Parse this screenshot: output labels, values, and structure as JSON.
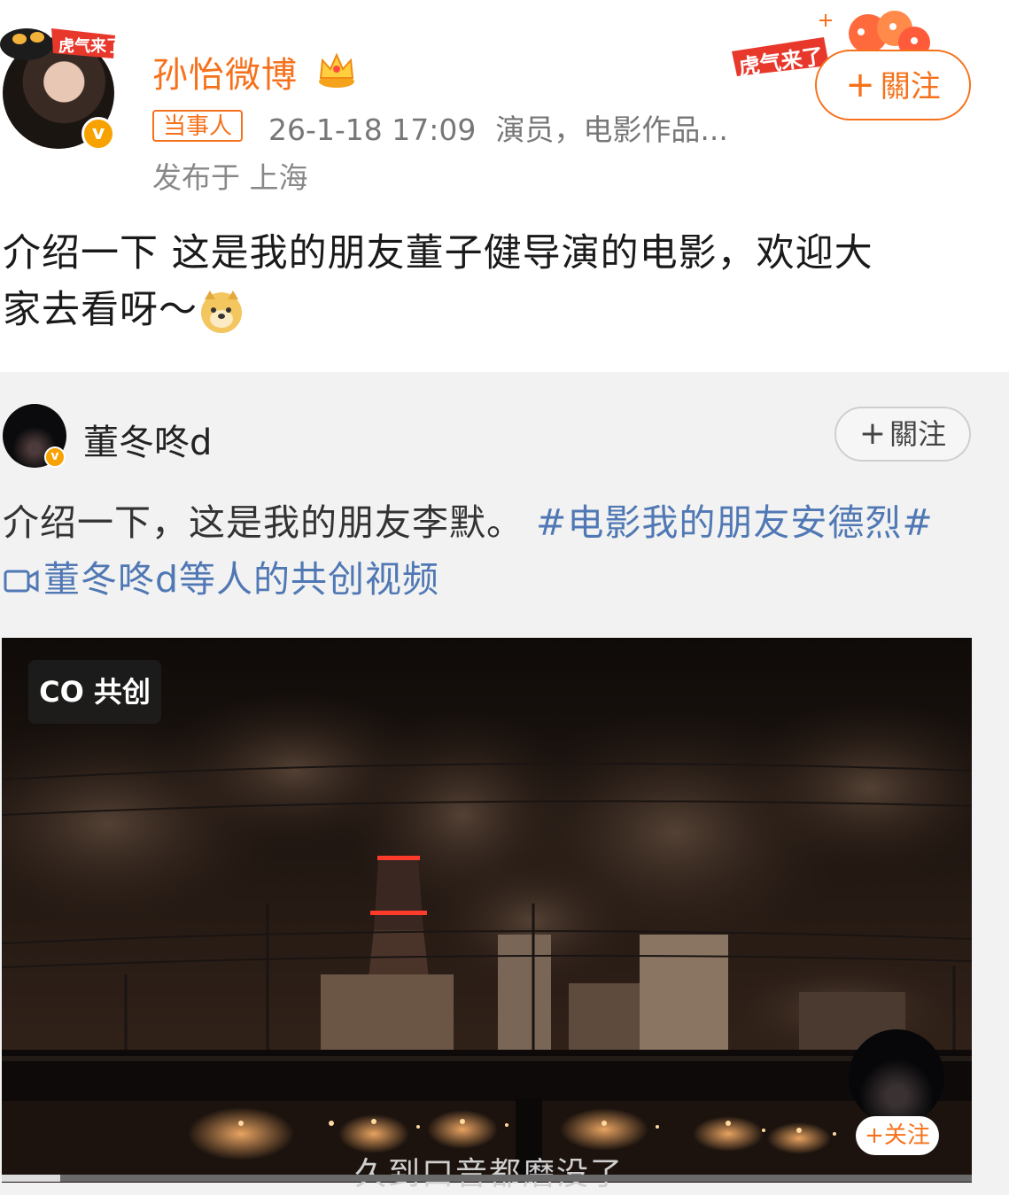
{
  "post": {
    "username": "孙怡微博",
    "tag": "当事人",
    "meta_time": "26-1-18 17:09",
    "meta_desc": "演员，电影作品...",
    "location": "发布于 上海",
    "follow_label": "關注",
    "text_line1": "介绍一下 这是我的朋友董子健导演的电影，欢迎大",
    "text_line2": "家去看呀～",
    "avatar_badge": "v",
    "decoration_text": "虎气来了"
  },
  "repost": {
    "username": "董冬咚d",
    "follow_label": "關注",
    "text_plain": "介绍一下，这是我的朋友李默。",
    "topic": "#电影我的朋友安德烈#",
    "collab_label": "董冬咚d等人的共创视频",
    "avatar_badge": "v"
  },
  "video": {
    "badge_label": "共创",
    "badge_prefix": "CO",
    "subtitle": "久到口音都磨没了",
    "creator_follow": "关注",
    "progress": 0.06
  },
  "icons": {
    "plus": "+",
    "crown": "crown-icon",
    "camera": "video-camera-icon",
    "doge": "doge-emoji-icon"
  },
  "colors": {
    "accent": "#f6711b",
    "link": "#5078b4",
    "badge": "#f7a200"
  }
}
